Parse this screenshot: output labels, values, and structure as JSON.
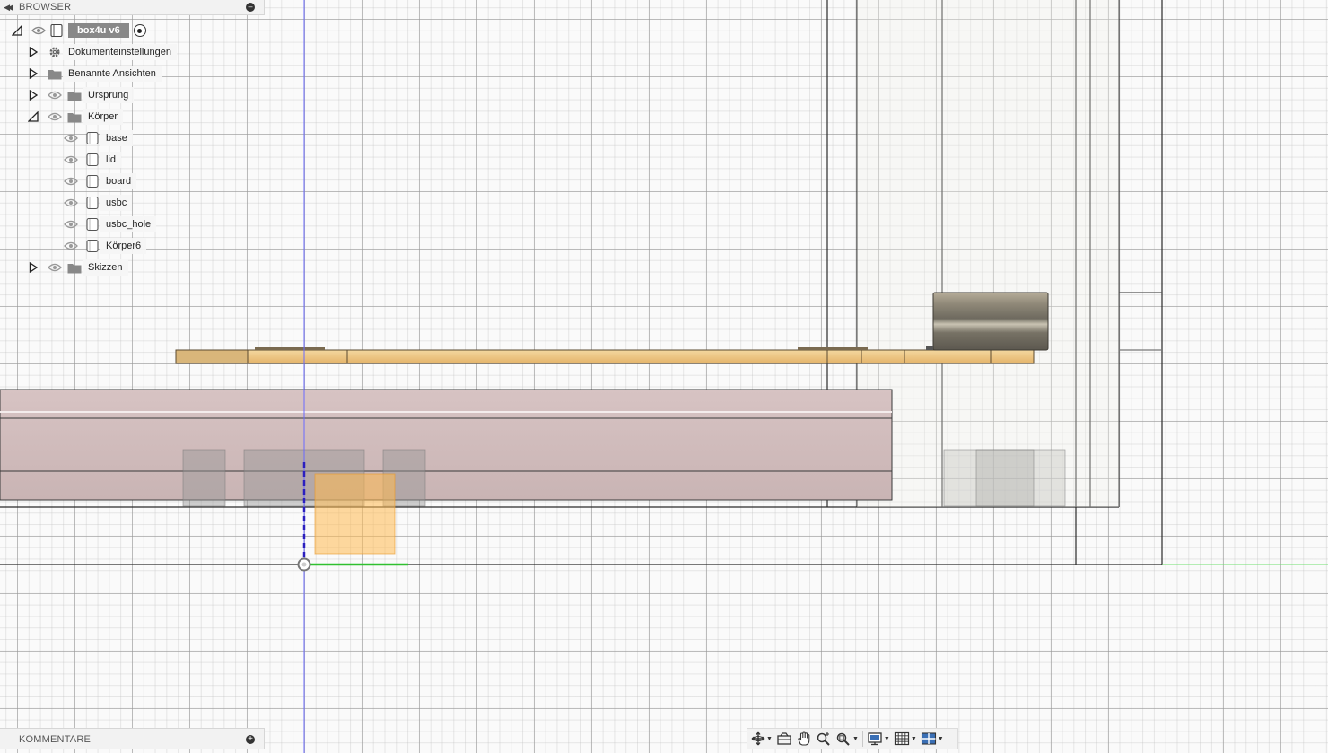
{
  "browser": {
    "title": "BROWSER",
    "root": {
      "label": "box4u v6"
    },
    "items": [
      {
        "label": "Dokumenteinstellungen",
        "icon": "gear-icon"
      },
      {
        "label": "Benannte Ansichten",
        "icon": "folder-icon"
      },
      {
        "label": "Ursprung",
        "icon": "folder-icon"
      },
      {
        "label": "Körper",
        "icon": "folder-icon",
        "expanded": true
      },
      {
        "label": "base",
        "icon": "body-icon"
      },
      {
        "label": "lid",
        "icon": "body-icon"
      },
      {
        "label": "board",
        "icon": "body-icon"
      },
      {
        "label": "usbc",
        "icon": "body-icon"
      },
      {
        "label": "usbc_hole",
        "icon": "body-icon"
      },
      {
        "label": "Körper6",
        "icon": "body-icon"
      },
      {
        "label": "Skizzen",
        "icon": "folder-icon"
      }
    ]
  },
  "comments": {
    "title": "KOMMENTARE"
  },
  "toolbar": {
    "tools": [
      "orbit-icon",
      "look-at-icon",
      "pan-hand-icon",
      "zoom-icon",
      "fit-zoom-icon",
      "display-settings-icon",
      "grid-icon",
      "viewports-icon"
    ]
  },
  "colors": {
    "board": "#f0c784",
    "base": "#d4c0c0",
    "usbc": "#8a8575",
    "selection": "#ffb84d",
    "z_axis": "#5a5aff",
    "x_axis": "#3ad33a"
  }
}
